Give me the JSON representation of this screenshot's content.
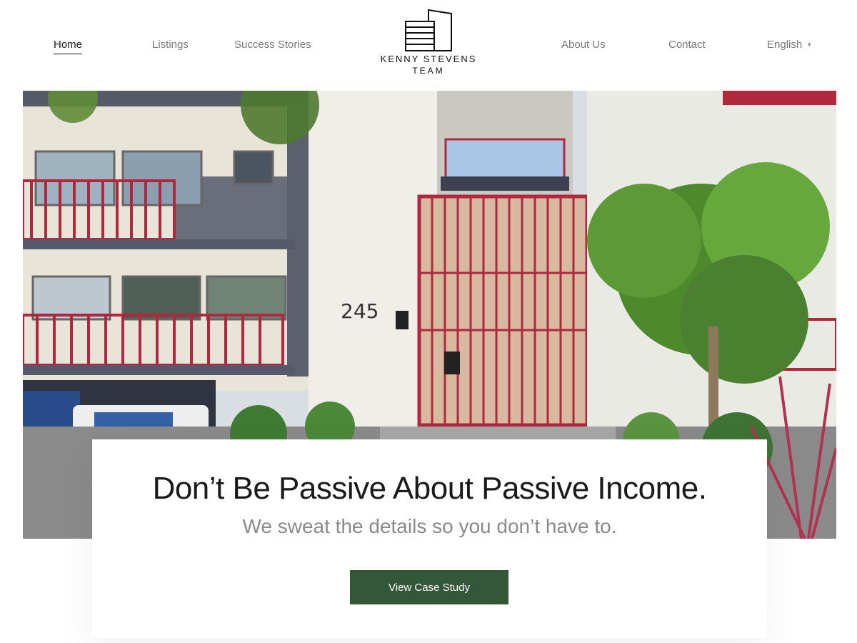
{
  "nav": {
    "left_items": [
      {
        "label": "Home",
        "active": true
      },
      {
        "label": "Listings",
        "active": false
      },
      {
        "label": "Success Stories",
        "active": false
      }
    ],
    "right_items": [
      {
        "label": "About Us",
        "active": false
      },
      {
        "label": "Contact",
        "active": false
      }
    ],
    "language": {
      "selected": "English",
      "icon": "caret-down-icon"
    }
  },
  "logo": {
    "name": "KENNY STEVENS",
    "sub": "TEAM",
    "icon": "building-icon"
  },
  "hero": {
    "image": "apartment-building-photo",
    "building_number": "245"
  },
  "card": {
    "headline": "Don’t Be Passive About Passive Income.",
    "subhead": "We sweat the details so you don’t have to.",
    "cta_label": "View Case Study",
    "cta_color": "#335738"
  }
}
